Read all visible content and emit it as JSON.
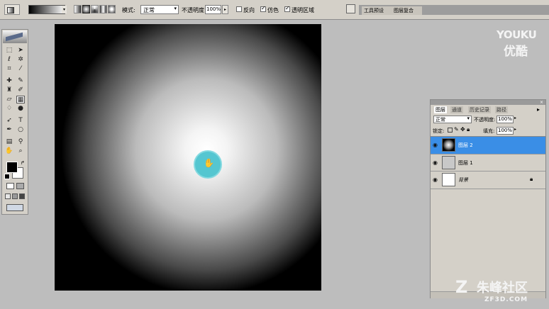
{
  "options_bar": {
    "mode_label": "模式:",
    "mode_value": "正常",
    "opacity_label": "不透明度:",
    "opacity_value": "100%",
    "reverse_label": "反向",
    "dither_label": "仿色",
    "transparency_label": "透明区域",
    "tab_tool_presets": "工具预设",
    "tab_layer_comps": "图层复合"
  },
  "tool_icons": [
    "marquee-icon",
    "move-icon",
    "lasso-icon",
    "magic-wand-icon",
    "crop-icon",
    "slice-icon",
    "healing-icon",
    "brush-icon",
    "stamp-icon",
    "history-brush-icon",
    "eraser-icon",
    "gradient-icon",
    "blur-icon",
    "dodge-icon",
    "path-select-icon",
    "type-icon",
    "pen-icon",
    "shape-icon",
    "notes-icon",
    "eyedropper-icon",
    "hand-icon",
    "zoom-icon"
  ],
  "layers_panel": {
    "tabs": [
      "图层",
      "通道",
      "历史记录",
      "路径"
    ],
    "blend_mode": "正常",
    "opacity_label": "不透明度:",
    "opacity_value": "100%",
    "lock_label": "锁定:",
    "fill_label": "填充:",
    "fill_value": "100%",
    "layers": [
      {
        "name": "图层 2",
        "selected": true
      },
      {
        "name": "图层 1",
        "selected": false
      },
      {
        "name": "背景",
        "selected": false,
        "locked": true
      }
    ]
  },
  "watermark": {
    "brand_top": "YOUKU",
    "brand_bottom": "优酷",
    "site_name": "朱峰社区",
    "site_url": "ZF3D.COM"
  },
  "colors": {
    "selection": "#3a8ee6",
    "cursor": "#4dc4cf",
    "ui_gray": "#d4d0c8"
  }
}
